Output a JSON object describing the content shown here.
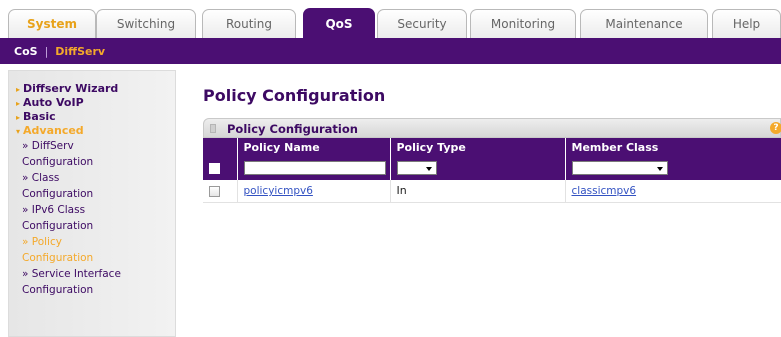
{
  "top_tabs": [
    "System",
    "Switching",
    "Routing",
    "QoS",
    "Security",
    "Monitoring",
    "Maintenance",
    "Help"
  ],
  "active_tab": "QoS",
  "sub_nav": {
    "cos": "CoS",
    "separator": "|",
    "diffserv": "DiffServ"
  },
  "sidebar": {
    "items": [
      {
        "label": "Diffserv Wizard"
      },
      {
        "label": "Auto VoIP"
      },
      {
        "label": "Basic"
      },
      {
        "label": "Advanced"
      }
    ],
    "sub_items": [
      {
        "line1": "» DiffServ",
        "line2": "Configuration"
      },
      {
        "line1": "» Class",
        "line2": "Configuration"
      },
      {
        "line1": "» IPv6 Class",
        "line2": "Configuration"
      },
      {
        "line1": "» Policy",
        "line2": "Configuration"
      },
      {
        "line1": "» Service Interface",
        "line2": "Configuration"
      }
    ]
  },
  "page_title": "Policy Configuration",
  "panel": {
    "title": "Policy Configuration",
    "help_icon": "?",
    "columns": [
      "Policy Name",
      "Policy Type",
      "Member Class"
    ],
    "rows": [
      {
        "policy_name": "policyicmpv6",
        "policy_type": "In",
        "member_class": "classicmpv6"
      }
    ]
  },
  "colors": {
    "purple": "#4b0f73",
    "orange": "#f4a92b",
    "link": "#3352c2"
  }
}
